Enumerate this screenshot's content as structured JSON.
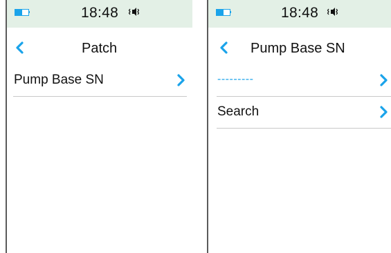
{
  "colors": {
    "accent": "#1aa3ea",
    "status_bar_bg": "#e3f0e6",
    "divider": "#c8c8c8",
    "text": "#111111"
  },
  "screens": [
    {
      "status_bar": {
        "time": "18:48",
        "battery_level": 0.55,
        "vibrate_icon": "vibrate-icon"
      },
      "header": {
        "back_icon": "chevron-left-icon",
        "title": "Patch"
      },
      "items": [
        {
          "label": "Pump Base SN",
          "icon": "chevron-right-icon"
        }
      ]
    },
    {
      "status_bar": {
        "time": "18:48",
        "battery_level": 0.55,
        "vibrate_icon": "vibrate-icon"
      },
      "header": {
        "back_icon": "chevron-left-icon",
        "title": "Pump Base SN"
      },
      "items": [
        {
          "label": "---------",
          "icon": "chevron-right-icon"
        },
        {
          "label": "Search",
          "icon": "chevron-right-icon"
        }
      ]
    }
  ]
}
